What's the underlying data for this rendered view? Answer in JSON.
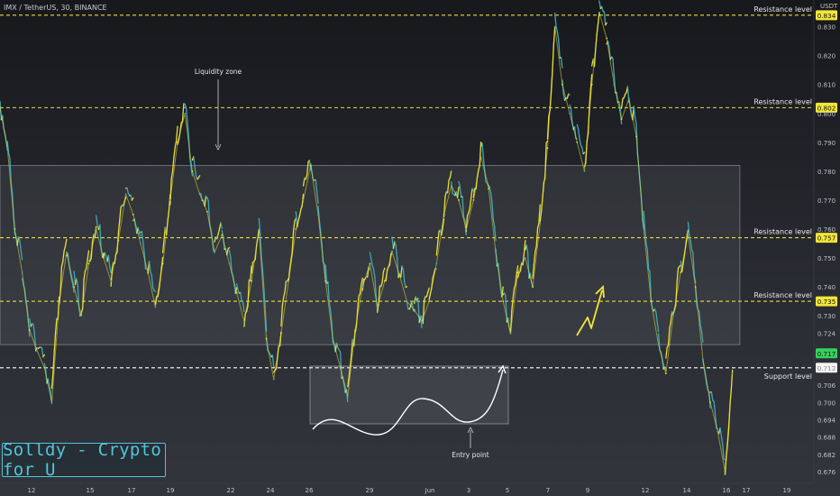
{
  "header": {
    "symbol": "IMX / TetherUS, 30, BINANCE"
  },
  "watermark": {
    "text": "Solldy - Crypto for U"
  },
  "colors": {
    "accent": "#52c4d8",
    "resistance_line": "#e8dd3a",
    "support_line": "#ffffff",
    "price_badge": "#f2e53a",
    "last_price_badge": "#36d15d",
    "candle_up": "#e8dd3a",
    "candle_down": "#3fa7b8"
  },
  "chart_data": {
    "type": "line",
    "title": "",
    "xlabel": "",
    "ylabel": "",
    "y_unit": "USDT",
    "ylim": [
      0.672,
      0.838
    ],
    "x_tick_labels": [
      "12",
      "15",
      "17",
      "19",
      "22",
      "24",
      "26",
      "29",
      "Jun",
      "3",
      "5",
      "7",
      "9",
      "12",
      "14",
      "16",
      "17",
      "19"
    ],
    "y_tick_labels": [
      "0.830",
      "0.820",
      "0.810",
      "0.800",
      "0.790",
      "0.780",
      "0.770",
      "0.760",
      "0.750",
      "0.740",
      "0.730",
      "0.724",
      "0.712",
      "0.706",
      "0.700",
      "0.694",
      "0.688",
      "0.682",
      "0.676"
    ],
    "axis_label": "USDT",
    "grid": false,
    "levels": [
      {
        "label": "Resistance level",
        "price": "0.834",
        "value": 0.834,
        "style": "resistance"
      },
      {
        "label": "Resistance level",
        "price": "0.802",
        "value": 0.802,
        "style": "resistance"
      },
      {
        "label": "Resistance level",
        "price": "0.757",
        "value": 0.757,
        "style": "resistance"
      },
      {
        "label": "Resistance level",
        "price": "0.735",
        "value": 0.735,
        "style": "resistance"
      },
      {
        "label": "Support level",
        "price": "0.712",
        "value": 0.712,
        "style": "support"
      }
    ],
    "last_price": {
      "price": "0.717",
      "value": 0.717
    },
    "zones": [
      {
        "label": "Liquidity zone",
        "x_start": 0,
        "x_end": 200,
        "y_top": 0.782,
        "y_bottom": 0.72
      }
    ],
    "entry_box": {
      "label": "Entry point",
      "x_start": 86,
      "x_end": 140,
      "y_top": 0.709,
      "y_bottom": 0.689
    },
    "projection": {
      "direction": "up",
      "from": 0.724,
      "to": 0.736
    },
    "series": [
      {
        "x": [
          0,
          2,
          4,
          6,
          8,
          10,
          12,
          14,
          16,
          18,
          20,
          22,
          24,
          26,
          28,
          30,
          32,
          34,
          36,
          38,
          40,
          42,
          44,
          46,
          48,
          50,
          52,
          54,
          56,
          58,
          60,
          62,
          64,
          66,
          68,
          70,
          72,
          74,
          76,
          78,
          80,
          82,
          84,
          86,
          88,
          90,
          92,
          94,
          96,
          98,
          100,
          102,
          104,
          106,
          108,
          110,
          112,
          114,
          116,
          118,
          120,
          122,
          124,
          126,
          128,
          130,
          132,
          134,
          136,
          138,
          140,
          142,
          144,
          146,
          148,
          150,
          152,
          154,
          156,
          158,
          160,
          162
        ],
        "values": [
          0.802,
          0.788,
          0.76,
          0.745,
          0.725,
          0.718,
          0.712,
          0.7,
          0.735,
          0.752,
          0.74,
          0.73,
          0.748,
          0.76,
          0.75,
          0.742,
          0.756,
          0.772,
          0.765,
          0.755,
          0.745,
          0.733,
          0.748,
          0.77,
          0.79,
          0.8,
          0.78,
          0.772,
          0.766,
          0.752,
          0.758,
          0.748,
          0.738,
          0.728,
          0.742,
          0.76,
          0.722,
          0.708,
          0.724,
          0.742,
          0.76,
          0.77,
          0.782,
          0.765,
          0.742,
          0.722,
          0.712,
          0.702,
          0.725,
          0.74,
          0.748,
          0.733,
          0.742,
          0.752,
          0.744,
          0.735,
          0.732,
          0.728,
          0.735,
          0.748,
          0.765,
          0.775,
          0.77,
          0.76,
          0.77,
          0.785,
          0.775,
          0.752,
          0.735,
          0.724,
          0.745,
          0.75,
          0.74,
          0.762,
          0.788,
          0.83,
          0.81,
          0.8,
          0.79,
          0.78,
          0.81,
          0.835
        ]
      }
    ],
    "series_tail": {
      "x": [
        164,
        166,
        168,
        170,
        172,
        174,
        176,
        178,
        180,
        182,
        184,
        186,
        188,
        190,
        192,
        194,
        196,
        198
      ],
      "values": [
        0.826,
        0.81,
        0.798,
        0.805,
        0.792,
        0.76,
        0.735,
        0.72,
        0.71,
        0.73,
        0.745,
        0.758,
        0.74,
        0.715,
        0.7,
        0.69,
        0.676,
        0.71
      ]
    }
  }
}
